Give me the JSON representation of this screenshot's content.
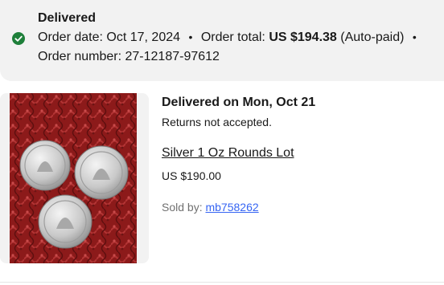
{
  "order": {
    "status": "Delivered",
    "order_date_label": "Order date:",
    "order_date": "Oct 17, 2024",
    "order_total_label": "Order total:",
    "order_total": "US $194.38",
    "payment_note": "(Auto-paid)",
    "order_number_label": "Order number:",
    "order_number": "27-12187-97612",
    "separator": "•"
  },
  "item": {
    "delivery": "Delivered on Mon, Oct 21",
    "returns": "Returns not accepted.",
    "title": "Silver 1 Oz Rounds Lot",
    "price": "US $190.00",
    "sold_by_label": "Sold by:",
    "seller": "mb758262"
  },
  "icons": {
    "status": "check-circle-icon"
  },
  "colors": {
    "success": "#1e7f3a",
    "link": "#3665f3"
  }
}
